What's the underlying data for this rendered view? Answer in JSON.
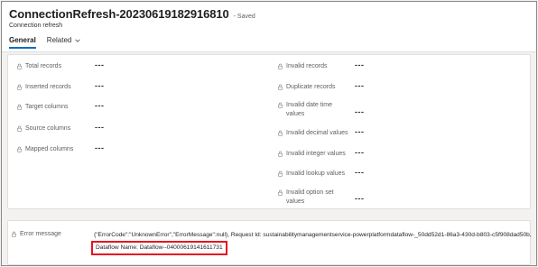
{
  "header": {
    "title": "ConnectionRefresh-20230619182916810",
    "saved_status": "- Saved",
    "entity_type": "Connection refresh",
    "tabs": [
      {
        "label": "General",
        "active": true
      },
      {
        "label": "Related",
        "active": false
      }
    ]
  },
  "fields_left": [
    {
      "label": "Total records",
      "value": "---"
    },
    {
      "label": "Inserted records",
      "value": "---"
    },
    {
      "label": "Target columns",
      "value": "---"
    },
    {
      "label": "Source columns",
      "value": "---"
    },
    {
      "label": "Mapped columns",
      "value": "---"
    }
  ],
  "fields_right": [
    {
      "label": "Invalid records",
      "value": "---"
    },
    {
      "label": "Duplicate records",
      "value": "---"
    },
    {
      "label_line1": "Invalid date time",
      "label_line2": "values",
      "value": "---"
    },
    {
      "label": "Invalid decimal values",
      "value": "---"
    },
    {
      "label": "Invalid integer values",
      "value": "---"
    },
    {
      "label": "Invalid lookup values",
      "value": "---"
    },
    {
      "label_line1": "Invalid option set",
      "label_line2": "values",
      "value": "---"
    }
  ],
  "error": {
    "label": "Error message",
    "line1": "{\"ErrorCode\":\"UnknownError\",\"ErrorMessage\":null}, Request Id: sustainabilitymanagementservice-powerplatformdataflow-_50dd52d1-86a3-430d-b803-c5f908dad50b,",
    "line2": "Dataflow Name: Dataflow--04000619141611731"
  },
  "colors": {
    "accent": "#0f6cbd",
    "highlight_border": "#e81123"
  }
}
